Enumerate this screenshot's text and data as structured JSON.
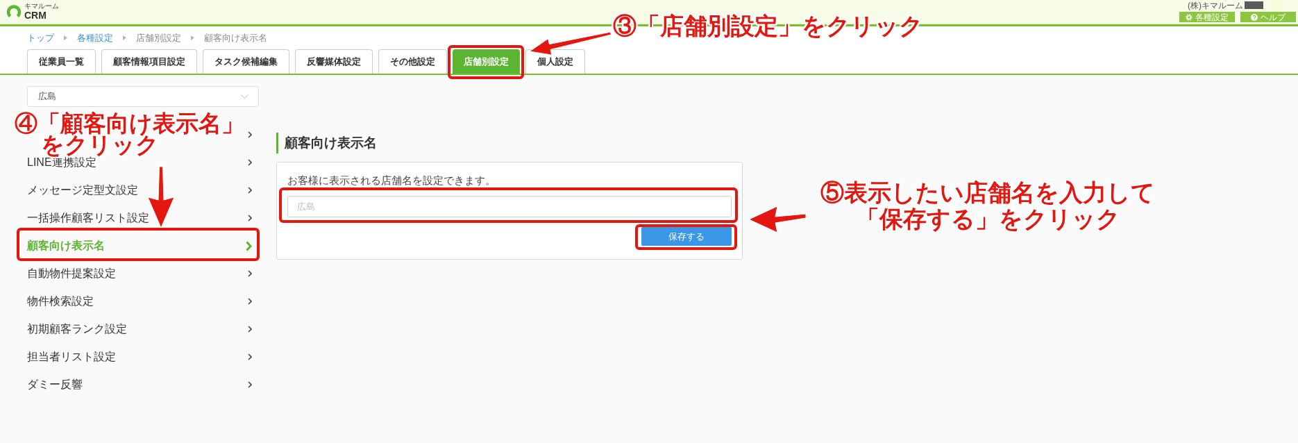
{
  "header": {
    "logo": {
      "caption": "キマルーム",
      "text": "CRM"
    },
    "account": "(株)キマルーム",
    "buttons": [
      {
        "kind": "settings",
        "label": "各種設定"
      },
      {
        "kind": "help",
        "label": "ヘルプ"
      }
    ]
  },
  "breadcrumb": [
    {
      "kind": "link",
      "label": "トップ"
    },
    {
      "kind": "link",
      "label": "各種設定"
    },
    {
      "kind": "text",
      "label": "店舗別設定"
    },
    {
      "kind": "text",
      "label": "顧客向け表示名"
    }
  ],
  "tabs": [
    {
      "label": "従業員一覧",
      "selected": false
    },
    {
      "label": "顧客情報項目設定",
      "selected": false
    },
    {
      "label": "タスク候補編集",
      "selected": false
    },
    {
      "label": "反響媒体設定",
      "selected": false
    },
    {
      "label": "その他設定",
      "selected": false
    },
    {
      "label": "店舗別設定",
      "selected": true
    },
    {
      "label": "個人設定",
      "selected": false
    }
  ],
  "store_select": {
    "value": "広島"
  },
  "sidebar": {
    "items": [
      {
        "selected": false
      },
      {
        "label": "LINE連携設定",
        "selected": false
      },
      {
        "label": "メッセージ定型文設定",
        "selected": false
      },
      {
        "label": "一括操作顧客リスト設定",
        "selected": false
      },
      {
        "label": "顧客向け表示名",
        "selected": true
      },
      {
        "label": "自動物件提案設定",
        "selected": false
      },
      {
        "label": "物件検索設定",
        "selected": false
      },
      {
        "label": "初期顧客ランク設定",
        "selected": false
      },
      {
        "label": "担当者リスト設定",
        "selected": false
      },
      {
        "label": "ダミー反響",
        "selected": false
      }
    ]
  },
  "section": {
    "title": "顧客向け表示名",
    "description": "お客様に表示される店舗名を設定できます。",
    "store_name_input": {
      "placeholder": "広島"
    },
    "save_button": "保存する"
  },
  "annotations": [
    {
      "lines": [
        "③「店舗別設定」をクリック"
      ]
    },
    {
      "lines": [
        "④「顧客向け表示名」",
        "をクリック"
      ]
    },
    {
      "lines": [
        "⑤表示したい店舗名を入力して",
        "「保存する」をクリック"
      ]
    }
  ]
}
